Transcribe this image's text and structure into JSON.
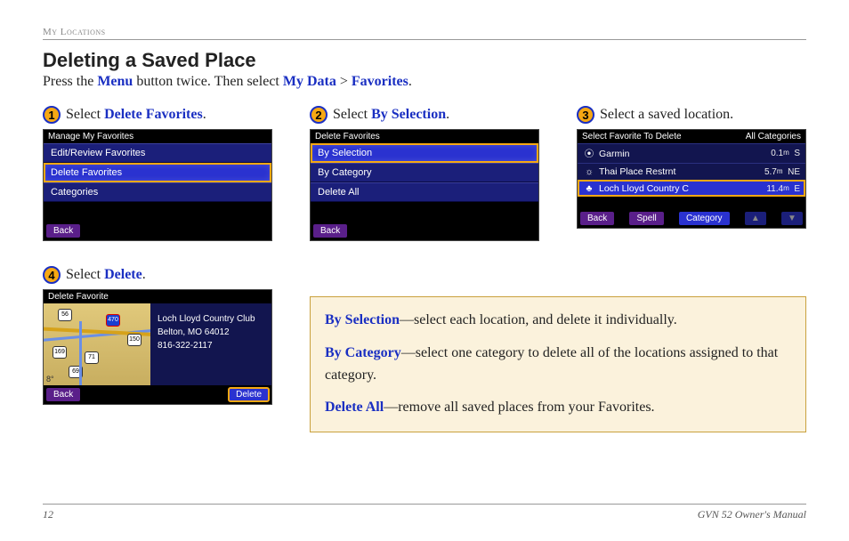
{
  "header": {
    "section": "My Locations"
  },
  "title": "Deleting a Saved Place",
  "intro": {
    "t1": "Press the ",
    "k1": "Menu",
    "t2": " button twice. Then select ",
    "k2": "My Data",
    "t3": " > ",
    "k3": "Favorites",
    "t4": "."
  },
  "steps": {
    "s1": {
      "num": "1",
      "pre": "Select ",
      "kw": "Delete Favorites",
      "post": "."
    },
    "s2": {
      "num": "2",
      "pre": "Select ",
      "kw": "By Selection",
      "post": "."
    },
    "s3": {
      "num": "3",
      "text": "Select a saved location."
    },
    "s4": {
      "num": "4",
      "pre": "Select ",
      "kw": "Delete",
      "post": "."
    }
  },
  "screen1": {
    "title": "Manage My Favorites",
    "items": [
      "Edit/Review Favorites",
      "Delete Favorites",
      "Categories"
    ],
    "highlight_index": 1,
    "back": "Back"
  },
  "screen2": {
    "title": "Delete Favorites",
    "items": [
      "By Selection",
      "By Category",
      "Delete All"
    ],
    "highlight_index": 0,
    "back": "Back"
  },
  "screen3": {
    "title": "Select Favorite To Delete",
    "category": "All Categories",
    "rows": [
      {
        "icon": "⦿",
        "name": "Garmin",
        "dist": "0.1",
        "dir": "S"
      },
      {
        "icon": "☼",
        "name": "Thai Place Restrnt",
        "dist": "5.7",
        "dir": "NE"
      },
      {
        "icon": "♣",
        "name": "Loch Lloyd Country C",
        "dist": "11.4",
        "dir": "E"
      }
    ],
    "highlight_index": 2,
    "footer": {
      "back": "Back",
      "spell": "Spell",
      "category": "Category"
    }
  },
  "screen4": {
    "title": "Delete Favorite",
    "loc_name": "Loch Lloyd Country Club",
    "loc_city": "Belton, MO 64012",
    "loc_phone": "816-322-2117",
    "shields": [
      "56",
      "470",
      "150",
      "169",
      "71",
      "69"
    ],
    "temp": "8°",
    "back": "Back",
    "delete": "Delete"
  },
  "infobox": {
    "r1": {
      "kw": "By Selection",
      "rest": "—select each location, and delete it individually."
    },
    "r2": {
      "kw": "By Category",
      "rest": "—select one category to delete all of the locations assigned to that category."
    },
    "r3": {
      "kw": "Delete All",
      "rest": "—remove all saved places from your Favorites."
    }
  },
  "footer": {
    "page": "12",
    "doc": "GVN 52 Owner's Manual"
  }
}
